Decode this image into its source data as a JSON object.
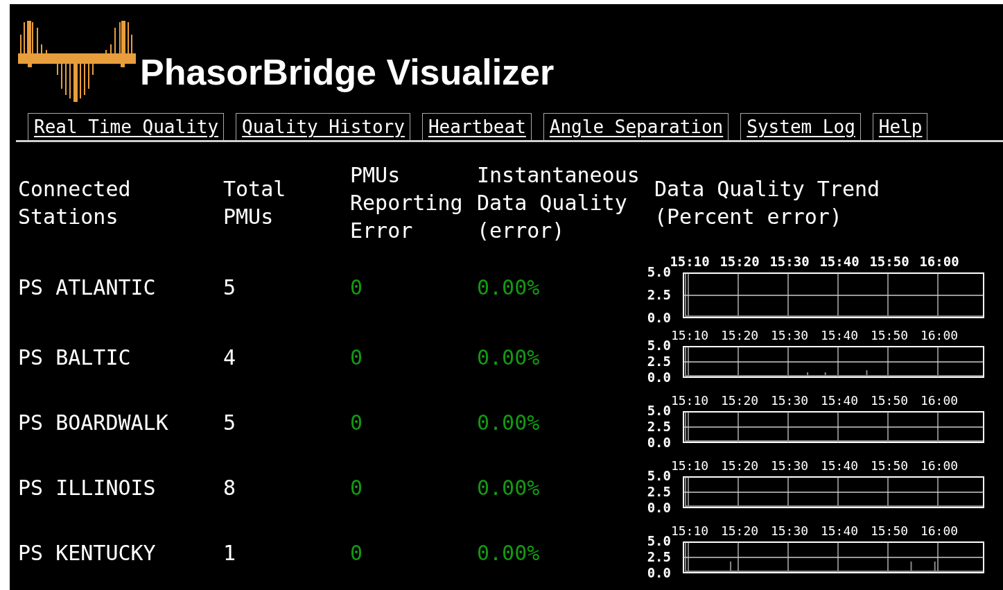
{
  "title": "PhasorBridge Visualizer",
  "tabs": [
    {
      "label": "Real Time Quality"
    },
    {
      "label": "Quality History"
    },
    {
      "label": "Heartbeat"
    },
    {
      "label": "Angle Separation"
    },
    {
      "label": "System Log"
    },
    {
      "label": "Help"
    }
  ],
  "table": {
    "columns": [
      "Connected Stations",
      "Total PMUs",
      "PMUs Reporting Error",
      "Instantaneous Data Quality (error)",
      "Data Quality Trend (Percent error)"
    ],
    "rows": [
      {
        "station": "PS ATLANTIC",
        "total_pmus": "5",
        "pmus_reporting_error": "0",
        "data_quality": "0.00%",
        "trend": {
          "x_ticks": [
            "15:10",
            "15:20",
            "15:30",
            "15:40",
            "15:50",
            "16:00"
          ],
          "y_ticks": [
            "5.0",
            "2.5",
            "0.0"
          ]
        }
      },
      {
        "station": "PS BALTIC",
        "total_pmus": "4",
        "pmus_reporting_error": "0",
        "data_quality": "0.00%",
        "trend": {
          "x_ticks": [
            "15:10",
            "15:20",
            "15:30",
            "15:40",
            "15:50",
            "16:00"
          ],
          "y_ticks": [
            "5.0",
            "2.5",
            "0.0"
          ]
        }
      },
      {
        "station": "PS BOARDWALK",
        "total_pmus": "5",
        "pmus_reporting_error": "0",
        "data_quality": "0.00%",
        "trend": {
          "x_ticks": [
            "15:10",
            "15:20",
            "15:30",
            "15:40",
            "15:50",
            "16:00"
          ],
          "y_ticks": [
            "5.0",
            "2.5",
            "0.0"
          ]
        }
      },
      {
        "station": "PS ILLINOIS",
        "total_pmus": "8",
        "pmus_reporting_error": "0",
        "data_quality": "0.00%",
        "trend": {
          "x_ticks": [
            "15:10",
            "15:20",
            "15:30",
            "15:40",
            "15:50",
            "16:00"
          ],
          "y_ticks": [
            "5.0",
            "2.5",
            "0.0"
          ]
        }
      },
      {
        "station": "PS KENTUCKY",
        "total_pmus": "1",
        "pmus_reporting_error": "0",
        "data_quality": "0.00%",
        "trend": {
          "x_ticks": [
            "15:10",
            "15:20",
            "15:30",
            "15:40",
            "15:50",
            "16:00"
          ],
          "y_ticks": [
            "5.0",
            "2.5",
            "0.0"
          ]
        }
      }
    ]
  }
}
